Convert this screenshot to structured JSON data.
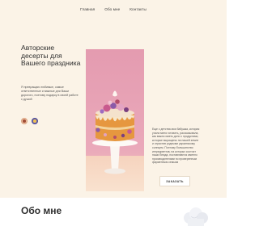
{
  "nav": {
    "items": [
      {
        "label": "Главная"
      },
      {
        "label": "Обо мне"
      },
      {
        "label": "Контакты"
      }
    ]
  },
  "hero": {
    "title": "Авторские десерты для Вашего праздника",
    "text": "Я превращаю любимые, самые ответственные и важные дни Ваши дорогого, поэтому подарку в своей работе с душой",
    "side_text": "Еще с детства моя бабушка, которая учила меня готовить, рассказывала, как важно иметь дело с продуктами, которые выращены на нашей земле и отрастив родными украинскому солнцем. Поэтому большинство ингредиентов, на которых состоят наши блюда, поставляются именно производителями по проверенным фирменным семьям",
    "order_label": "ЗАКАЗАТЬ"
  },
  "about": {
    "title": "Обо мне"
  },
  "icons": {
    "badge_1": "award-badge-icon",
    "badge_2": "quality-badge-icon",
    "hat": "chef-hat-icon"
  },
  "colors": {
    "hero_bg": "#fbf3e7",
    "photo_bg": "#e9a8b9",
    "photo_floor": "#f6d6c4",
    "accent_purple": "#6c67b7"
  }
}
